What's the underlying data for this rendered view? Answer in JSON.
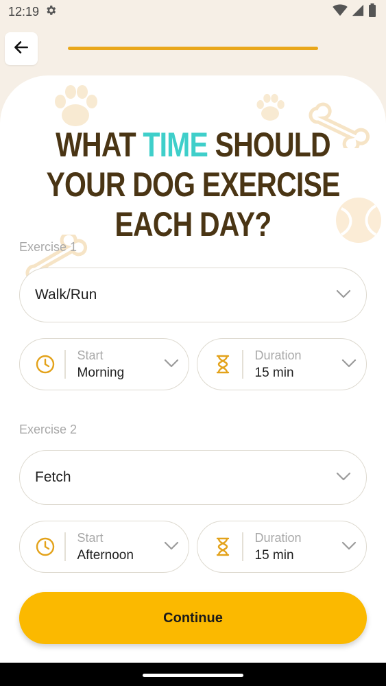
{
  "status_bar": {
    "time": "12:19",
    "icons": [
      "settings-icon",
      "wifi-icon",
      "signal-icon",
      "battery-icon"
    ]
  },
  "header": {
    "back_icon": "arrow-left-icon",
    "progress_fraction": 1.0
  },
  "headline": {
    "part1": "WHAT ",
    "accent": "TIME",
    "part2": " SHOULD YOUR DOG EXERCISE EACH DAY?"
  },
  "exercises": [
    {
      "label": "Exercise 1",
      "activity": "Walk/Run",
      "start_label": "Start",
      "start_value": "Morning",
      "duration_label": "Duration",
      "duration_value": "15 min"
    },
    {
      "label": "Exercise 2",
      "activity": "Fetch",
      "start_label": "Start",
      "start_value": "Afternoon",
      "duration_label": "Duration",
      "duration_value": "15 min"
    }
  ],
  "continue_label": "Continue",
  "colors": {
    "accent_yellow": "#fbb900",
    "progress": "#e9a71b",
    "headline": "#4a3514",
    "headline_accent": "#3fcfca",
    "icon": "#e3a21a"
  }
}
